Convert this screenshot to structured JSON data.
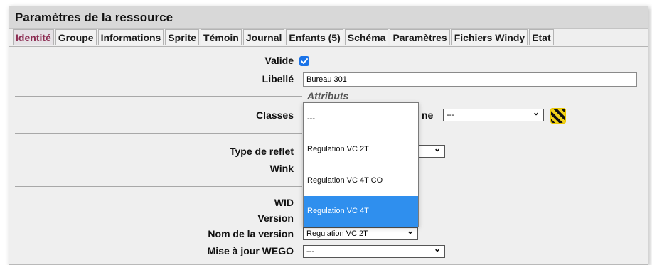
{
  "window": {
    "title": "Paramètres de la ressource"
  },
  "tabs": [
    "Identité",
    "Groupe",
    "Informations",
    "Sprite",
    "Témoin",
    "Journal",
    "Enfants (5)",
    "Schéma",
    "Paramètres",
    "Fichiers Windy",
    "Etat"
  ],
  "active_tab": "Identité",
  "form": {
    "valide_label": "Valide",
    "valide_checked": true,
    "libelle_label": "Libellé",
    "libelle_value": "Bureau 301",
    "attributs_legend": "Attributs",
    "classes_label": "Classes",
    "classes_value": "---",
    "zone_label_fragment": "ne",
    "zone_value": "---",
    "type_reflet_label": "Type de reflet",
    "wink_label": "Wink",
    "wid_label": "WID",
    "version_label": "Version",
    "nom_version_label": "Nom de la version",
    "nom_version_value": "Regulation VC 2T",
    "mise_a_jour_label": "Mise à jour WEGO",
    "mise_a_jour_value": "---"
  },
  "dropdown": {
    "options": [
      "---",
      "Regulation VC 2T",
      "Regulation VC 4T CO",
      "Regulation VC 4T"
    ],
    "highlighted": "Regulation VC 4T"
  },
  "icons": {
    "checkmark": "check-icon",
    "chevron": "chevron-down-icon",
    "hazard": "hazard-stripes-icon"
  },
  "colors": {
    "active_tab": "#8c2c52",
    "checkbox": "#1a73e8",
    "highlight": "#2f8fee"
  }
}
